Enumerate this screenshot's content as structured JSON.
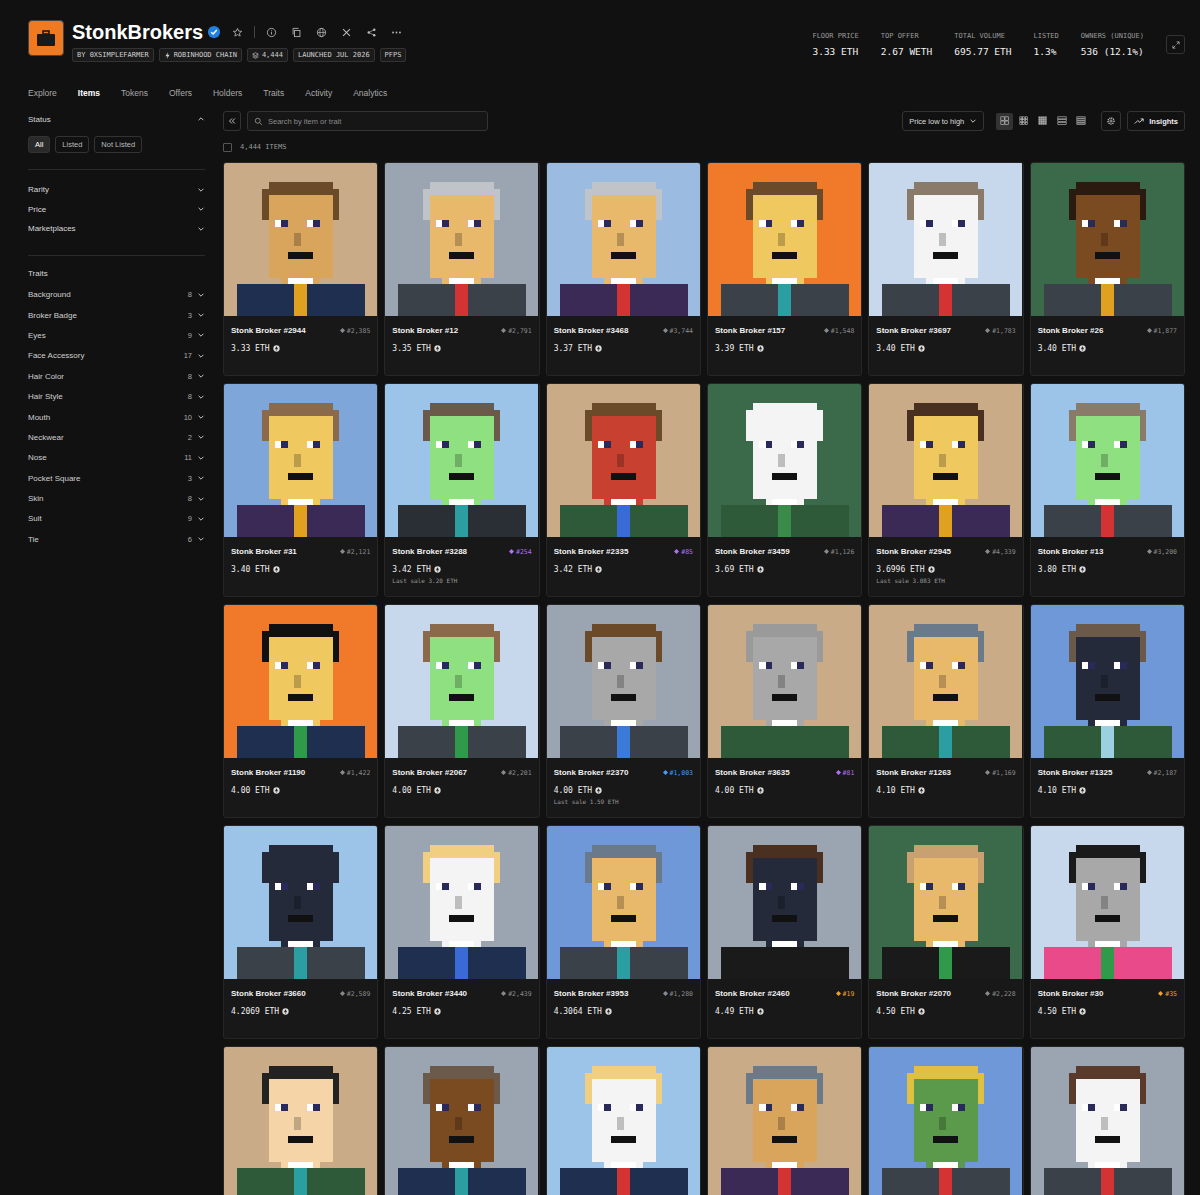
{
  "header": {
    "title": "StonkBrokers",
    "verified": true,
    "chips": [
      {
        "label": "BY 0XSIMPLEFARMER",
        "kind": "creator"
      },
      {
        "label": "ROBINHOOD CHAIN",
        "kind": "chain"
      },
      {
        "label": "4,444",
        "kind": "supply"
      },
      {
        "label": "LAUNCHED JUL 2026",
        "kind": "date"
      },
      {
        "label": "PFPS",
        "kind": "category"
      }
    ],
    "stats": [
      {
        "label": "FLOOR PRICE",
        "value": "3.33 ETH"
      },
      {
        "label": "TOP OFFER",
        "value": "2.67 WETH"
      },
      {
        "label": "TOTAL VOLUME",
        "value": "695.77 ETH"
      },
      {
        "label": "LISTED",
        "value": "1.3%"
      },
      {
        "label": "OWNERS (UNIQUE)",
        "value": "536 (12.1%)"
      }
    ]
  },
  "tabs": [
    {
      "label": "Explore",
      "selected": false
    },
    {
      "label": "Items",
      "selected": true
    },
    {
      "label": "Tokens",
      "selected": false
    },
    {
      "label": "Offers",
      "selected": false
    },
    {
      "label": "Holders",
      "selected": false
    },
    {
      "label": "Traits",
      "selected": false
    },
    {
      "label": "Activity",
      "selected": false
    },
    {
      "label": "Analytics",
      "selected": false
    }
  ],
  "sidebar": {
    "status": {
      "title": "Status",
      "expanded": true,
      "filters": [
        {
          "label": "All",
          "selected": true
        },
        {
          "label": "Listed",
          "selected": false
        },
        {
          "label": "Not Listed",
          "selected": false
        }
      ]
    },
    "sections": [
      {
        "label": "Rarity",
        "expanded": false
      },
      {
        "label": "Price",
        "expanded": false
      },
      {
        "label": "Marketplaces",
        "expanded": false
      }
    ],
    "traits": {
      "title": "Traits",
      "items": [
        {
          "label": "Background",
          "count": "8"
        },
        {
          "label": "Broker Badge",
          "count": "3"
        },
        {
          "label": "Eyes",
          "count": "9"
        },
        {
          "label": "Face Accessory",
          "count": "17"
        },
        {
          "label": "Hair Color",
          "count": "8"
        },
        {
          "label": "Hair Style",
          "count": "8"
        },
        {
          "label": "Mouth",
          "count": "10"
        },
        {
          "label": "Neckwear",
          "count": "2"
        },
        {
          "label": "Nose",
          "count": "11"
        },
        {
          "label": "Pocket Square",
          "count": "3"
        },
        {
          "label": "Skin",
          "count": "8"
        },
        {
          "label": "Suit",
          "count": "9"
        },
        {
          "label": "Tie",
          "count": "6"
        }
      ]
    }
  },
  "toolbar": {
    "search_placeholder": "Search by item or trait",
    "sort": "Price low to high",
    "view_modes": [
      {
        "selected": true
      },
      {
        "selected": false
      },
      {
        "selected": false
      },
      {
        "selected": false
      },
      {
        "selected": false
      }
    ],
    "insights": "Insights"
  },
  "count": {
    "label": "4,444 ITEMS",
    "checked": false
  },
  "items": [
    {
      "name": "Stonk Broker #2944",
      "rank": "#2,385",
      "rank_color": "#8a8a8a",
      "price": "3.33 ETH",
      "art": {
        "bg": "#c9ab88",
        "hair": "#6b4a2a",
        "skin": "#d9a55c",
        "suit": "#1f2f4f",
        "tie": "#e0a020"
      }
    },
    {
      "name": "Stonk Broker #12",
      "rank": "#2,791",
      "rank_color": "#8a8a8a",
      "price": "3.35 ETH",
      "art": {
        "bg": "#9aa5b1",
        "hair": "#c0c4c8",
        "skin": "#e8b86b",
        "suit": "#3b4148",
        "tie": "#d33333"
      }
    },
    {
      "name": "Stonk Broker #3468",
      "rank": "#3,744",
      "rank_color": "#8a8a8a",
      "price": "3.37 ETH",
      "art": {
        "bg": "#9bbbe0",
        "hair": "#c0c4c8",
        "skin": "#e8b86b",
        "suit": "#3a2a55",
        "tie": "#d33333"
      }
    },
    {
      "name": "Stonk Broker #157",
      "rank": "#1,548",
      "rank_color": "#8a8a8a",
      "price": "3.39 ETH",
      "art": {
        "bg": "#f07a2a",
        "hair": "#6b4a2a",
        "skin": "#f0c860",
        "suit": "#3b4148",
        "tie": "#2a9ea0"
      }
    },
    {
      "name": "Stonk Broker #3697",
      "rank": "#1,783",
      "rank_color": "#8a8a8a",
      "price": "3.40 ETH",
      "art": {
        "bg": "#c7d8ec",
        "hair": "#8a7a6a",
        "skin": "#f4f4f4",
        "suit": "#3b4148",
        "tie": "#d33333"
      }
    },
    {
      "name": "Stonk Broker #26",
      "rank": "#1,877",
      "rank_color": "#8a8a8a",
      "price": "3.40 ETH",
      "art": {
        "bg": "#3a6a4a",
        "hair": "#2a1a10",
        "skin": "#7a4a20",
        "suit": "#3b4148",
        "tie": "#e0a020"
      }
    },
    {
      "name": "Stonk Broker #31",
      "rank": "#2,121",
      "rank_color": "#8a8a8a",
      "price": "3.40 ETH",
      "art": {
        "bg": "#7fa6d8",
        "hair": "#8a6a4a",
        "skin": "#f0c860",
        "suit": "#3a2a55",
        "tie": "#e0a020"
      }
    },
    {
      "name": "Stonk Broker #3288",
      "rank": "#254",
      "rank_color": "#b070f0",
      "price": "3.42 ETH",
      "last_sale": "Last sale 3.20 ETH",
      "art": {
        "bg": "#9bc4e8",
        "hair": "#6b5a4a",
        "skin": "#8ee080",
        "suit": "#2a2f35",
        "tie": "#2a9ea0"
      }
    },
    {
      "name": "Stonk Broker #2335",
      "rank": "#85",
      "rank_color": "#b070f0",
      "price": "3.42 ETH",
      "art": {
        "bg": "#c9ab88",
        "hair": "#6b4a2a",
        "skin": "#c84030",
        "suit": "#2e5a3a",
        "tie": "#3a6ad8"
      }
    },
    {
      "name": "Stonk Broker #3459",
      "rank": "#1,126",
      "rank_color": "#8a8a8a",
      "price": "3.69 ETH",
      "art": {
        "bg": "#3a6a4a",
        "hair": "#f4f4f4",
        "skin": "#f4f4f4",
        "suit": "#2e5a3a",
        "tie": "#3a8a4a"
      }
    },
    {
      "name": "Stonk Broker #2945",
      "rank": "#4,339",
      "rank_color": "#8a8a8a",
      "price": "3.6996 ETH",
      "last_sale": "Last sale 3.083 ETH",
      "art": {
        "bg": "#c9ab88",
        "hair": "#4a3020",
        "skin": "#f0c860",
        "suit": "#3a2a55",
        "tie": "#e0a020"
      }
    },
    {
      "name": "Stonk Broker #13",
      "rank": "#3,200",
      "rank_color": "#8a8a8a",
      "price": "3.80 ETH",
      "art": {
        "bg": "#9bc4e8",
        "hair": "#8a7a6a",
        "skin": "#8ee080",
        "suit": "#3b4148",
        "tie": "#d33333"
      }
    },
    {
      "name": "Stonk Broker #1190",
      "rank": "#1,422",
      "rank_color": "#8a8a8a",
      "price": "4.00 ETH",
      "art": {
        "bg": "#f07a2a",
        "hair": "#111111",
        "skin": "#f0c860",
        "suit": "#1f2f4f",
        "tie": "#2e9a4a"
      }
    },
    {
      "name": "Stonk Broker #2067",
      "rank": "#2,201",
      "rank_color": "#8a8a8a",
      "price": "4.00 ETH",
      "art": {
        "bg": "#c7d8ec",
        "hair": "#8a6a4a",
        "skin": "#8ee080",
        "suit": "#3b4148",
        "tie": "#2e9a4a"
      }
    },
    {
      "name": "Stonk Broker #2370",
      "rank": "#1,003",
      "rank_color": "#4a9af0",
      "price": "4.00 ETH",
      "last_sale": "Last sale 1.59 ETH",
      "art": {
        "bg": "#9aa5b1",
        "hair": "#6b4a2a",
        "skin": "#a8a8a8",
        "suit": "#3b4148",
        "tie": "#3a7ad8"
      }
    },
    {
      "name": "Stonk Broker #3635",
      "rank": "#81",
      "rank_color": "#b070f0",
      "price": "4.00 ETH",
      "art": {
        "bg": "#c9ab88",
        "hair": "#9a9a9a",
        "skin": "#a8a8a8",
        "suit": "#2e5a3a",
        "tie": "#2e5a3a"
      }
    },
    {
      "name": "Stonk Broker #1263",
      "rank": "#1,169",
      "rank_color": "#8a8a8a",
      "price": "4.10 ETH",
      "art": {
        "bg": "#c9ab88",
        "hair": "#6a7a8a",
        "skin": "#e8b86b",
        "suit": "#2e5a3a",
        "tie": "#2a9ea0"
      }
    },
    {
      "name": "Stonk Broker #1325",
      "rank": "#2,187",
      "rank_color": "#8a8a8a",
      "price": "4.10 ETH",
      "art": {
        "bg": "#6f98d8",
        "hair": "#6b5a4a",
        "skin": "#252a3a",
        "suit": "#2e5a3a",
        "tie": "#9ad0e0"
      }
    },
    {
      "name": "Stonk Broker #3660",
      "rank": "#2,589",
      "rank_color": "#8a8a8a",
      "price": "4.2069 ETH",
      "art": {
        "bg": "#9bc4e8",
        "hair": "#252a3a",
        "skin": "#252a3a",
        "suit": "#3b4148",
        "tie": "#2a9ea0"
      }
    },
    {
      "name": "Stonk Broker #3440",
      "rank": "#2,439",
      "rank_color": "#8a8a8a",
      "price": "4.25 ETH",
      "art": {
        "bg": "#9aa5b1",
        "hair": "#f0d080",
        "skin": "#f4f4f4",
        "suit": "#1f2f4f",
        "tie": "#3a6ad8"
      }
    },
    {
      "name": "Stonk Broker #3953",
      "rank": "#1,280",
      "rank_color": "#8a8a8a",
      "price": "4.3064 ETH",
      "art": {
        "bg": "#6f98d8",
        "hair": "#6a7a8a",
        "skin": "#e8b86b",
        "suit": "#3b4148",
        "tie": "#2a9ea0"
      }
    },
    {
      "name": "Stonk Broker #2460",
      "rank": "#19",
      "rank_color": "#f0a030",
      "price": "4.49 ETH",
      "art": {
        "bg": "#9aa5b1",
        "hair": "#4a3020",
        "skin": "#252a3a",
        "suit": "#1a1a1a",
        "tie": "#1a1a1a"
      }
    },
    {
      "name": "Stonk Broker #2070",
      "rank": "#2,228",
      "rank_color": "#8a8a8a",
      "price": "4.50 ETH",
      "art": {
        "bg": "#3a6a4a",
        "hair": "#c9a070",
        "skin": "#e8b86b",
        "suit": "#1a1a1a",
        "tie": "#2e9a4a"
      }
    },
    {
      "name": "Stonk Broker #30",
      "rank": "#35",
      "rank_color": "#f0a030",
      "price": "4.50 ETH",
      "art": {
        "bg": "#c7d8ec",
        "hair": "#1a1a1a",
        "skin": "#a8a8a8",
        "suit": "#e84a8a",
        "tie": "#2e9a4a"
      }
    },
    {
      "art": {
        "bg": "#c9ab88",
        "hair": "#222222",
        "skin": "#f5d5a8",
        "suit": "#2e5a3a",
        "tie": "#2a9ea0"
      }
    },
    {
      "art": {
        "bg": "#9aa5b1",
        "hair": "#6b5a4a",
        "skin": "#7a4a20",
        "suit": "#1f2f4f",
        "tie": "#2a9ea0"
      }
    },
    {
      "art": {
        "bg": "#9bc4e8",
        "hair": "#f0d080",
        "skin": "#f4f4f4",
        "suit": "#1f2f4f",
        "tie": "#d33333"
      }
    },
    {
      "art": {
        "bg": "#c9ab88",
        "hair": "#6a7a8a",
        "skin": "#d9a55c",
        "suit": "#3a2a55",
        "tie": "#d33333"
      }
    },
    {
      "art": {
        "bg": "#6f98d8",
        "hair": "#e0c040",
        "skin": "#5a9a4a",
        "suit": "#3b4148",
        "tie": "#d33333"
      }
    },
    {
      "art": {
        "bg": "#9aa5b1",
        "hair": "#5a3a2a",
        "skin": "#f4f4f4",
        "suit": "#3b4148",
        "tie": "#d33333"
      }
    }
  ]
}
